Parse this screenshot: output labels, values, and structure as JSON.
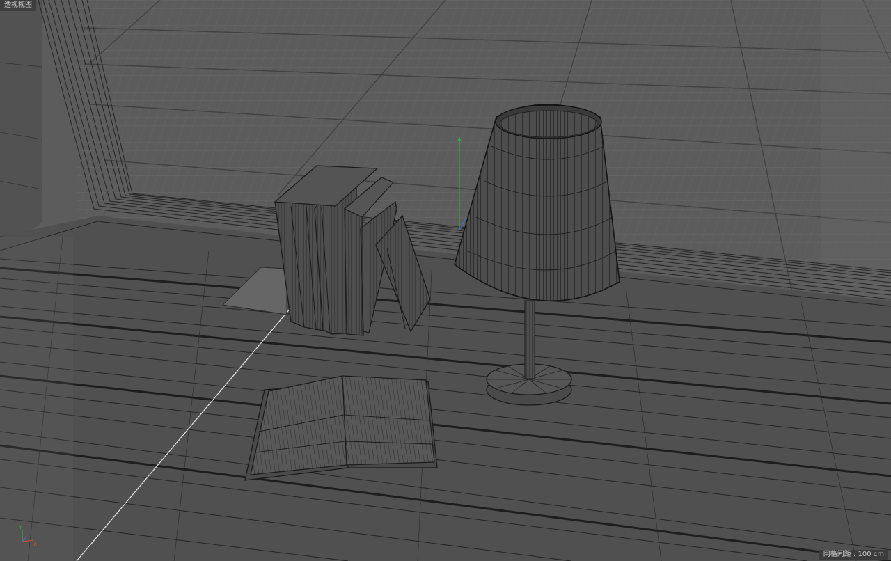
{
  "viewport": {
    "label": "透视视图",
    "grid_spacing_label": "网格间距",
    "grid_spacing_value": "100 cm"
  },
  "axis_widget": {
    "y_label": "Y",
    "x_label": "X"
  },
  "scene_objects": [
    "window-frame",
    "floor-planks",
    "book-row",
    "open-book",
    "table-lamp",
    "world-axis",
    "selection-ray"
  ],
  "colors": {
    "viewport_bg": "#5a5a5a",
    "wire": "#1e1e1e",
    "y_axis": "#3fa34a",
    "x_axis": "#c94a3a",
    "z_axis": "#4a6fd0"
  }
}
